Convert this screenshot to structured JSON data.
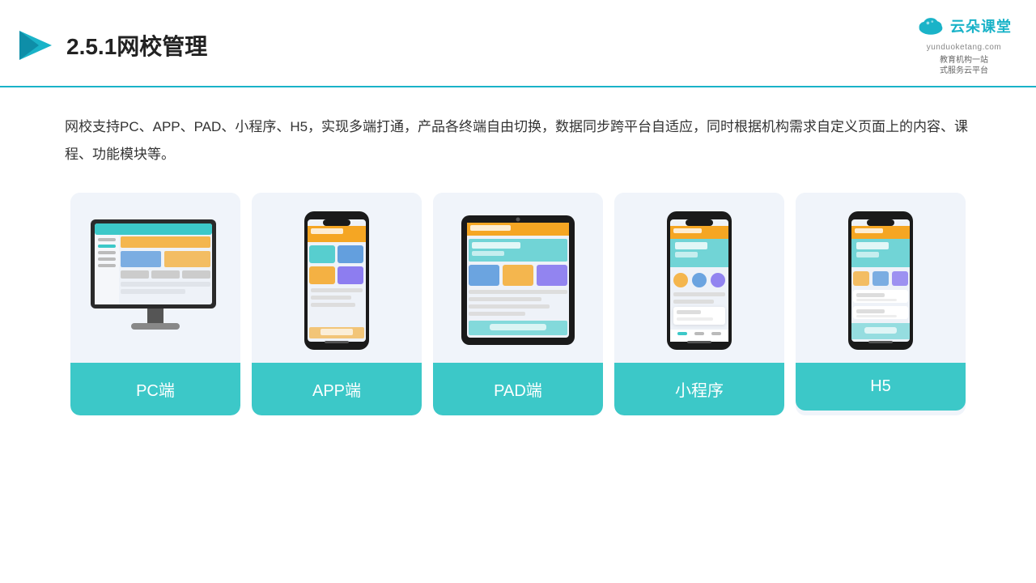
{
  "header": {
    "section_number": "2.5.1",
    "title": "网校管理",
    "brand_name_cn": "云朵课堂",
    "brand_name_en": "yunduoketang.com",
    "brand_slogan_line1": "教育机构一站",
    "brand_slogan_line2": "式服务云平台"
  },
  "description": {
    "text": "网校支持PC、APP、PAD、小程序、H5，实现多端打通，产品各终端自由切换，数据同步跨平台自适应，同时根据机构需求自定义页面上的内容、课程、功能模块等。"
  },
  "cards": [
    {
      "id": "pc",
      "label": "PC端"
    },
    {
      "id": "app",
      "label": "APP端"
    },
    {
      "id": "pad",
      "label": "PAD端"
    },
    {
      "id": "miniapp",
      "label": "小程序"
    },
    {
      "id": "h5",
      "label": "H5"
    }
  ],
  "accent_color": "#3cc8c8",
  "bg_card_color": "#f0f4fa"
}
